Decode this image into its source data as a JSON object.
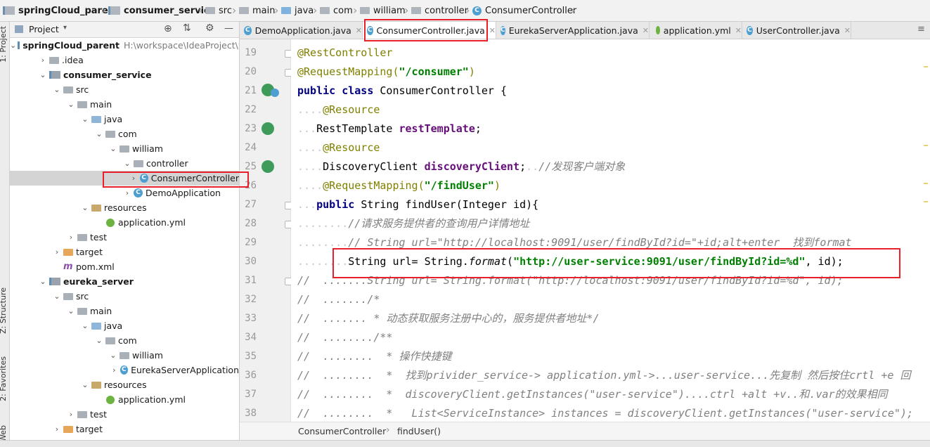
{
  "breadcrumb": [
    "springCloud_parent",
    "consumer_service",
    "src",
    "main",
    "java",
    "com",
    "william",
    "controller",
    "ConsumerController"
  ],
  "stripe_tabs": [
    "1: Project",
    "Z: Structure",
    "2: Favorites",
    "Web"
  ],
  "project_panel": {
    "title": "Project",
    "tree": [
      {
        "label": "springCloud_parent",
        "extra": "H:\\workspace\\IdeaProject\\S",
        "icon": "module",
        "bold": true,
        "arrow": "down",
        "depth": 0
      },
      {
        "label": ".idea",
        "icon": "folder",
        "arrow": "right",
        "depth": 1
      },
      {
        "label": "consumer_service",
        "icon": "module",
        "bold": true,
        "arrow": "down",
        "depth": 1
      },
      {
        "label": "src",
        "icon": "folder",
        "arrow": "down",
        "depth": 2
      },
      {
        "label": "main",
        "icon": "folder",
        "arrow": "down",
        "depth": 3
      },
      {
        "label": "java",
        "icon": "src-folder",
        "arrow": "down",
        "depth": 4
      },
      {
        "label": "com",
        "icon": "folder",
        "arrow": "down",
        "depth": 5
      },
      {
        "label": "william",
        "icon": "folder",
        "arrow": "down",
        "depth": 6
      },
      {
        "label": "controller",
        "icon": "folder",
        "arrow": "down",
        "depth": 7
      },
      {
        "label": "ConsumerController",
        "icon": "class",
        "arrow": "right",
        "depth": 8,
        "selected": true
      },
      {
        "label": "DemoApplication",
        "icon": "class",
        "arrow": "right",
        "depth": 7
      },
      {
        "label": "resources",
        "icon": "res-folder",
        "arrow": "down",
        "depth": 4
      },
      {
        "label": "application.yml",
        "icon": "yml",
        "arrow": "",
        "depth": 5
      },
      {
        "label": "test",
        "icon": "folder",
        "arrow": "right",
        "depth": 3
      },
      {
        "label": "target",
        "icon": "target-folder",
        "arrow": "right",
        "depth": 2
      },
      {
        "label": "pom.xml",
        "icon": "maven",
        "arrow": "",
        "depth": 2
      },
      {
        "label": "eureka_server",
        "icon": "module",
        "bold": true,
        "arrow": "down",
        "depth": 1
      },
      {
        "label": "src",
        "icon": "folder",
        "arrow": "down",
        "depth": 2
      },
      {
        "label": "main",
        "icon": "folder",
        "arrow": "down",
        "depth": 3
      },
      {
        "label": "java",
        "icon": "src-folder",
        "arrow": "down",
        "depth": 4
      },
      {
        "label": "com",
        "icon": "folder",
        "arrow": "down",
        "depth": 5
      },
      {
        "label": "william",
        "icon": "folder",
        "arrow": "down",
        "depth": 6
      },
      {
        "label": "EurekaServerApplication",
        "icon": "class",
        "arrow": "right",
        "depth": 7
      },
      {
        "label": "resources",
        "icon": "res-folder",
        "arrow": "down",
        "depth": 4
      },
      {
        "label": "application.yml",
        "icon": "yml",
        "arrow": "",
        "depth": 5
      },
      {
        "label": "test",
        "icon": "folder",
        "arrow": "right",
        "depth": 3
      },
      {
        "label": "target",
        "icon": "target-folder",
        "arrow": "right",
        "depth": 2
      }
    ]
  },
  "tabs": [
    {
      "label": "DemoApplication.java",
      "icon": "class"
    },
    {
      "label": "ConsumerController.java",
      "icon": "class",
      "active": true
    },
    {
      "label": "EurekaServerApplication.java",
      "icon": "class"
    },
    {
      "label": "application.yml",
      "icon": "yml"
    },
    {
      "label": "UserController.java",
      "icon": "class"
    }
  ],
  "editor": {
    "line_numbers": [
      "19",
      "20",
      "21",
      "22",
      "23",
      "24",
      "25",
      "26",
      "27",
      "28",
      "29",
      "30",
      "31",
      "32",
      "33",
      "34",
      "35",
      "36",
      "37",
      "38"
    ],
    "lines": [
      [
        [
          "ann",
          "@RestController"
        ]
      ],
      [
        [
          "ann",
          "@RequestMapping("
        ],
        [
          "str",
          "\"/consumer\""
        ],
        [
          "ann",
          ")"
        ]
      ],
      [
        [
          "kw",
          "public class "
        ],
        [
          "",
          "ConsumerController {"
        ]
      ],
      [
        [
          "ws",
          "...."
        ],
        [
          "ann",
          "@Resource"
        ]
      ],
      [
        [
          "ws",
          "..."
        ],
        [
          "",
          "RestTemplate "
        ],
        [
          "fld",
          "restTemplate"
        ],
        [
          "",
          ";"
        ]
      ],
      [
        [
          "ws",
          "...."
        ],
        [
          "ann",
          "@Resource"
        ]
      ],
      [
        [
          "ws",
          "...."
        ],
        [
          "",
          "DiscoveryClient "
        ],
        [
          "fld",
          "discoveryClient"
        ],
        [
          "",
          ";"
        ],
        [
          "ws",
          ".."
        ],
        [
          "cm",
          "//发现客户端对象"
        ]
      ],
      [
        [
          "ws",
          "...."
        ],
        [
          "ann",
          "@RequestMapping("
        ],
        [
          "str",
          "\"/findUser\""
        ],
        [
          "ann",
          ")"
        ]
      ],
      [
        [
          "ws",
          "..."
        ],
        [
          "kw",
          "public "
        ],
        [
          "",
          "String findUser(Integer id){"
        ]
      ],
      [
        [
          "ws",
          "........"
        ],
        [
          "cm",
          "//请求服务提供者的查询用户详情地址"
        ]
      ],
      [
        [
          "ws",
          "........"
        ],
        [
          "cm",
          "// String url=\"http://localhost:9091/user/findById?id=\"+id;alt+enter  找到format"
        ]
      ],
      [
        [
          "ws",
          "........"
        ],
        [
          "",
          "String url= String."
        ],
        [
          "fn",
          "format"
        ],
        [
          "",
          "("
        ],
        [
          "str",
          "\"http://user-service:9091/user/findById?id=%d\""
        ],
        [
          "",
          ", id);"
        ]
      ],
      [
        [
          "cm",
          "//  .......String url= String.format(\"http://localhost:9091/user/findById?id=%d\", id);"
        ]
      ],
      [
        [
          "cm",
          "//  ......./*"
        ]
      ],
      [
        [
          "cm",
          "//  ....... * 动态获取服务注册中心的，服务提供者地址*/"
        ]
      ],
      [
        [
          "cm",
          "//  ......../**"
        ]
      ],
      [
        [
          "cm",
          "//  ........  * 操作快捷键"
        ]
      ],
      [
        [
          "cm",
          "//  ........  *  找到privider_service-> application.yml->...user-service...先复制 然后按住crtl +e 回"
        ]
      ],
      [
        [
          "cm",
          "//  ........  *  discoveryClient.getInstances(\"user-service\")....ctrl +alt +v..和.var的效果相同"
        ]
      ],
      [
        [
          "cm",
          "//  ........  *   List<ServiceInstance> instances = discoveryClient.getInstances(\"user-service\");"
        ]
      ]
    ]
  },
  "editor_breadcrumb": [
    "ConsumerController",
    "findUser()"
  ]
}
